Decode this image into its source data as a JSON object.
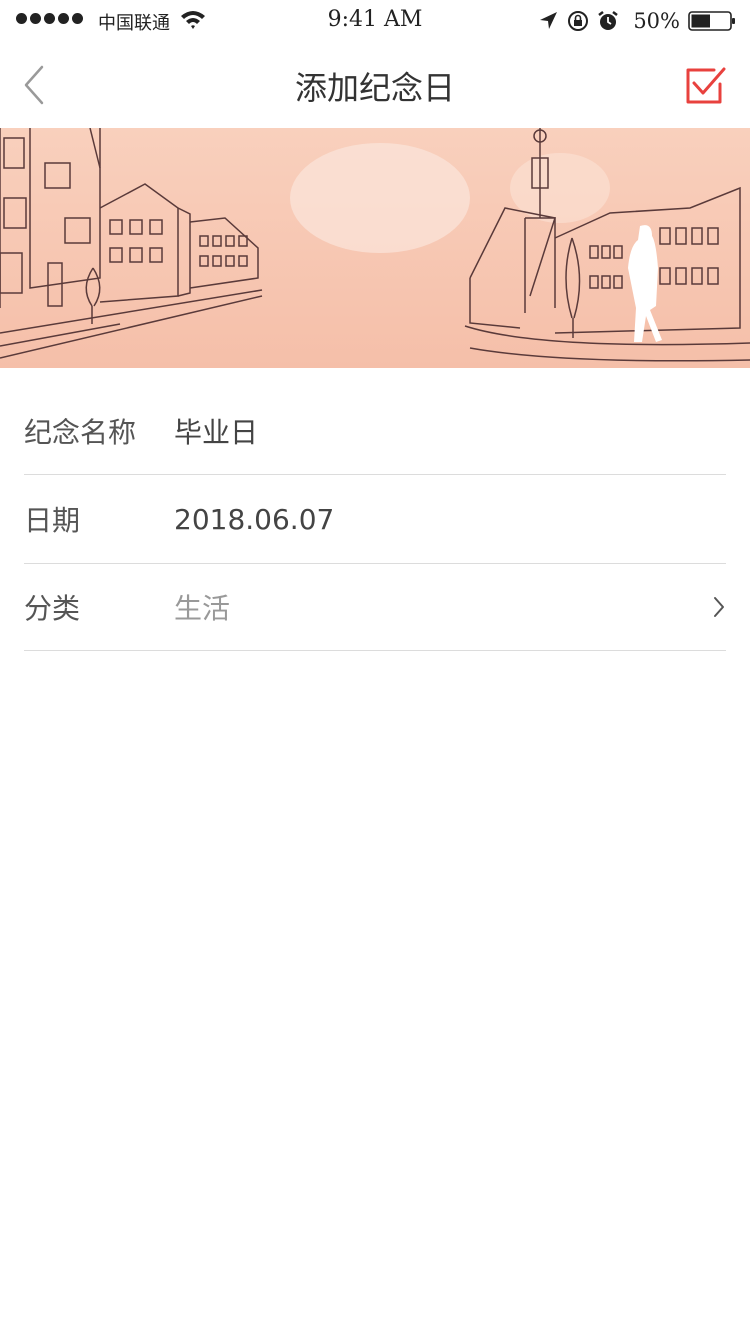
{
  "status_bar": {
    "carrier": "中国联通",
    "time": "9:41 AM",
    "battery_percent": "50%",
    "battery_level": 0.5,
    "icons": [
      "signal-dots",
      "wifi-icon",
      "location-arrow-icon",
      "rotation-lock-icon",
      "alarm-icon",
      "battery-icon"
    ]
  },
  "nav": {
    "title": "添加纪念日",
    "back_icon": "chevron-left-icon",
    "confirm_icon": "checkbox-check-icon",
    "accent_color": "#e8413e"
  },
  "banner": {
    "description_icon": "town-street-illustration",
    "background_color": "#f8c9b4"
  },
  "form": {
    "name_label": "纪念名称",
    "name_value": "毕业日",
    "date_label": "日期",
    "date_value": "2018.06.07",
    "category_label": "分类",
    "category_value": "生活",
    "category_icon": "chevron-right-icon"
  }
}
